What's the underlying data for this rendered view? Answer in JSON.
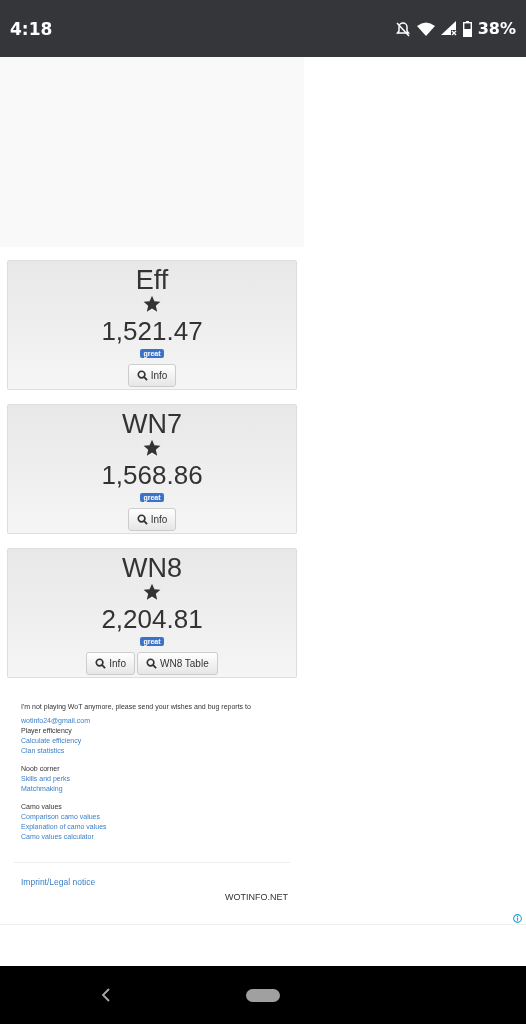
{
  "status_bar": {
    "time": "4:18",
    "battery": "38%"
  },
  "cards": [
    {
      "title": "Eff",
      "value": "1,521.47",
      "badge": "great",
      "buttons": [
        "Info"
      ]
    },
    {
      "title": "WN7",
      "value": "1,568.86",
      "badge": "great",
      "buttons": [
        "Info"
      ]
    },
    {
      "title": "WN8",
      "value": "2,204.81",
      "badge": "great",
      "buttons": [
        "Info",
        "WN8 Table"
      ]
    }
  ],
  "footer": {
    "intro": "I'm not playing WoT anymore, please send your wishes and bug reports to",
    "email": "wotinfo24@gmail.com",
    "sections": [
      {
        "heading": "Player efficiency",
        "links": [
          "Calculate efficiency",
          "Clan statistics"
        ]
      },
      {
        "heading": "Noob corner",
        "links": [
          "Skills and perks",
          "Matchmaking"
        ]
      },
      {
        "heading": "Camo values",
        "links": [
          "Comparison camo values",
          "Explanation of camo values",
          "Camo values calculator"
        ]
      }
    ],
    "legal": "Imprint/Legal notice",
    "brand": "WOTINFO.NET"
  }
}
